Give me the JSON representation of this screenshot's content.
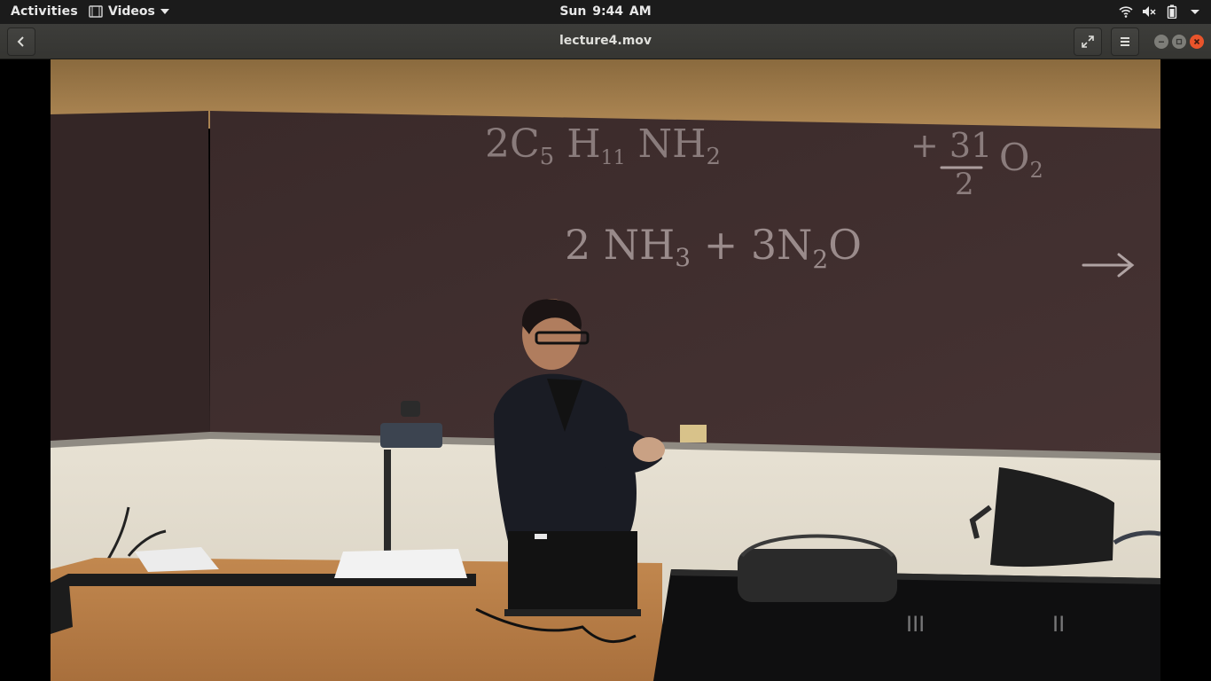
{
  "topbar": {
    "activities": "Activities",
    "app_menu": "Videos",
    "app_menu_icon": "film-icon",
    "clock": "Sun  9:44 AM",
    "tray_icons": [
      "wifi-icon",
      "volume-muted-icon",
      "battery-icon",
      "system-menu-arrow-icon"
    ]
  },
  "window": {
    "title": "lecture4.mov",
    "back_icon": "back-arrow-icon",
    "fullscreen_icon": "fullscreen-icon",
    "menu_icon": "hamburger-menu-icon",
    "controls": [
      "minimize-icon",
      "maximize-icon",
      "close-icon"
    ]
  },
  "video": {
    "board_line_1": "2C5 H11 NH2 + 31/2 O2",
    "board_line_2": "2NH3 + 3N2O →",
    "table_markings": [
      "III",
      "II"
    ]
  },
  "colors": {
    "topbar_bg": "#1b1b1b",
    "headerbar_bg": "#383835",
    "close_button": "#e9542b",
    "chalkboard": "#3d2c2c",
    "chalk": "#d9cfcf"
  }
}
